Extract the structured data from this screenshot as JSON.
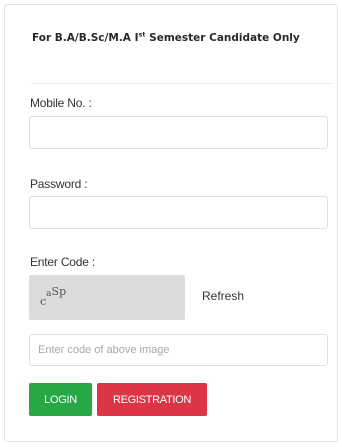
{
  "heading": {
    "prefix": "For B.A/B.Sc/M.A I",
    "superscript": "st",
    "suffix": " Semester Candidate Only"
  },
  "form": {
    "mobile_label": "Mobile No. :",
    "password_label": "Password :",
    "code_label": "Enter Code :",
    "captcha_chars": [
      "c",
      "a",
      "Sp"
    ],
    "refresh_label": "Refresh",
    "code_placeholder": "Enter code of above image"
  },
  "buttons": {
    "login_label": "LOGIN",
    "registration_label": "REGISTRATION"
  },
  "colors": {
    "login": "#27a745",
    "registration": "#dc3545"
  }
}
